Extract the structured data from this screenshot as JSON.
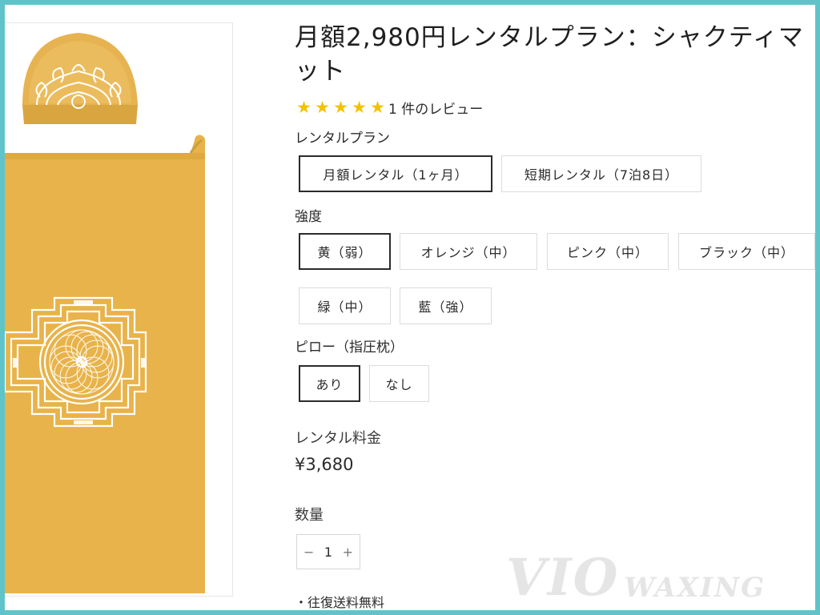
{
  "product": {
    "title": "月額2,980円レンタルプラン：シャクティマット",
    "rating_stars": 5,
    "review_count_text": "1 件のレビュー"
  },
  "options": {
    "plan": {
      "label": "レンタルプラン",
      "choices": [
        "月額レンタル（1ヶ月）",
        "短期レンタル（7泊8日）"
      ],
      "selected": "月額レンタル（1ヶ月）"
    },
    "intensity": {
      "label": "強度",
      "choices": [
        "黄（弱）",
        "オレンジ（中）",
        "ピンク（中）",
        "ブラック（中）",
        "緑（中）",
        "藍（強）"
      ],
      "selected": "黄（弱）"
    },
    "pillow": {
      "label": "ピロー（指圧枕）",
      "choices": [
        "あり",
        "なし"
      ],
      "selected": "あり"
    }
  },
  "price": {
    "label": "レンタル料金",
    "value": "¥3,680"
  },
  "quantity": {
    "label": "数量",
    "value": "1",
    "minus": "−",
    "plus": "+"
  },
  "note": "・往復送料無料",
  "watermark": {
    "part1": "VIO",
    "part2": "WAXING"
  },
  "colors": {
    "frame": "#5fc4c9",
    "mat": "#e8b34a",
    "star": "#f2c200",
    "selected_border": "#2b2b2b"
  }
}
